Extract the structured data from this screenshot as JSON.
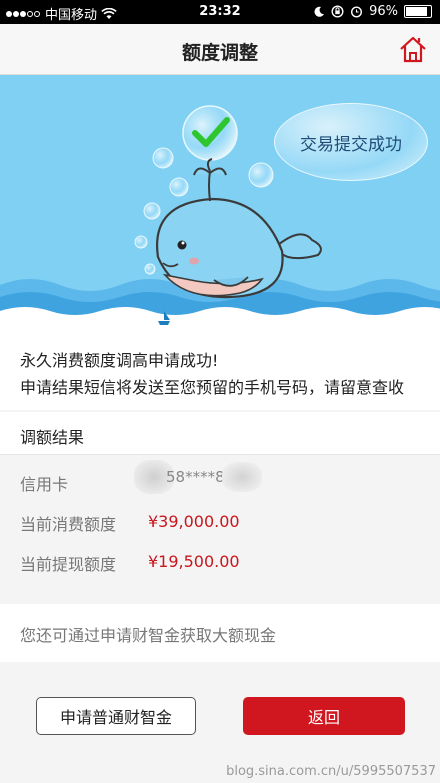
{
  "status_bar": {
    "carrier": "中国移动",
    "time": "23:32",
    "battery": "96%",
    "battery_level": 0.96
  },
  "nav": {
    "title": "额度调整",
    "home_icon": "home-icon"
  },
  "banner": {
    "bubble_text": "交易提交成功",
    "check_icon": "check-icon"
  },
  "message": {
    "line1": "永久消费额度调高申请成功!",
    "line2": "申请结果短信将发送至您预留的手机号码，请留意查收"
  },
  "result": {
    "section_title": "调额结果",
    "card_label": "信用卡",
    "card_number": "58****8",
    "consume_label": "当前消费额度",
    "consume_value": "¥39,000.00",
    "cash_label": "当前提现额度",
    "cash_value": "¥19,500.00"
  },
  "promo": {
    "text": "您还可通过申请财智金获取大额现金"
  },
  "buttons": {
    "apply_label": "申请普通财智金",
    "back_label": "返回"
  },
  "watermark": "blog.sina.com.cn/u/5995507537",
  "colors": {
    "accent_red": "#d0161e",
    "sky_blue": "#7fd0f2",
    "success_green": "#2ec62e"
  }
}
